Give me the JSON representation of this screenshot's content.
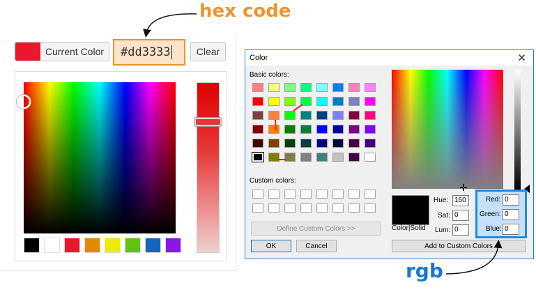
{
  "annotations": {
    "hex_label": "hex code",
    "rgb_label": "rgb"
  },
  "colors": {
    "accent_orange": "#e8922f",
    "accent_blue": "#1e88e5",
    "current": "#e8192c"
  },
  "widget": {
    "current_color_label": "Current Color",
    "hex_value": "#dd3333",
    "clear_label": "Clear",
    "palette": [
      "#000000",
      "#ffffff",
      "#e8192c",
      "#e08a00",
      "#eded00",
      "#5ec40e",
      "#1565c0",
      "#8a17e8"
    ]
  },
  "dialog": {
    "title": "Color",
    "close_icon": "close-icon",
    "basic_colors_label": "Basic colors:",
    "custom_colors_label": "Custom colors:",
    "basic_colors": [
      "#ff8080",
      "#ffff80",
      "#80ff80",
      "#00ff80",
      "#80ffff",
      "#0080ff",
      "#ff80c0",
      "#ff80ff",
      "#ff0000",
      "#ffff00",
      "#80ff00",
      "#00ff40",
      "#00ffff",
      "#0080c0",
      "#8080c0",
      "#ff00ff",
      "#804040",
      "#ff8040",
      "#00ff00",
      "#008080",
      "#004080",
      "#8080ff",
      "#800040",
      "#ff0080",
      "#800000",
      "#ff8000",
      "#008000",
      "#008040",
      "#0000ff",
      "#0000a0",
      "#800080",
      "#8000ff",
      "#400000",
      "#804000",
      "#004000",
      "#004040",
      "#000080",
      "#000040",
      "#400040",
      "#400080",
      "#000000",
      "#808000",
      "#808040",
      "#808080",
      "#408080",
      "#c0c0c0",
      "#400040",
      "#ffffff"
    ],
    "define_custom_label": "Define Custom Colors >>",
    "ok_label": "OK",
    "cancel_label": "Cancel",
    "color_solid_label": "Color|Solid",
    "hue_label": "Hue:",
    "hue_value": "160",
    "sat_label": "Sat:",
    "sat_value": "0",
    "lum_label": "Lum:",
    "lum_value": "0",
    "red_label": "Red:",
    "red_value": "0",
    "green_label": "Green:",
    "green_value": "0",
    "blue_label": "Blue:",
    "blue_value": "0",
    "add_custom_label": "Add to Custom Colors"
  }
}
